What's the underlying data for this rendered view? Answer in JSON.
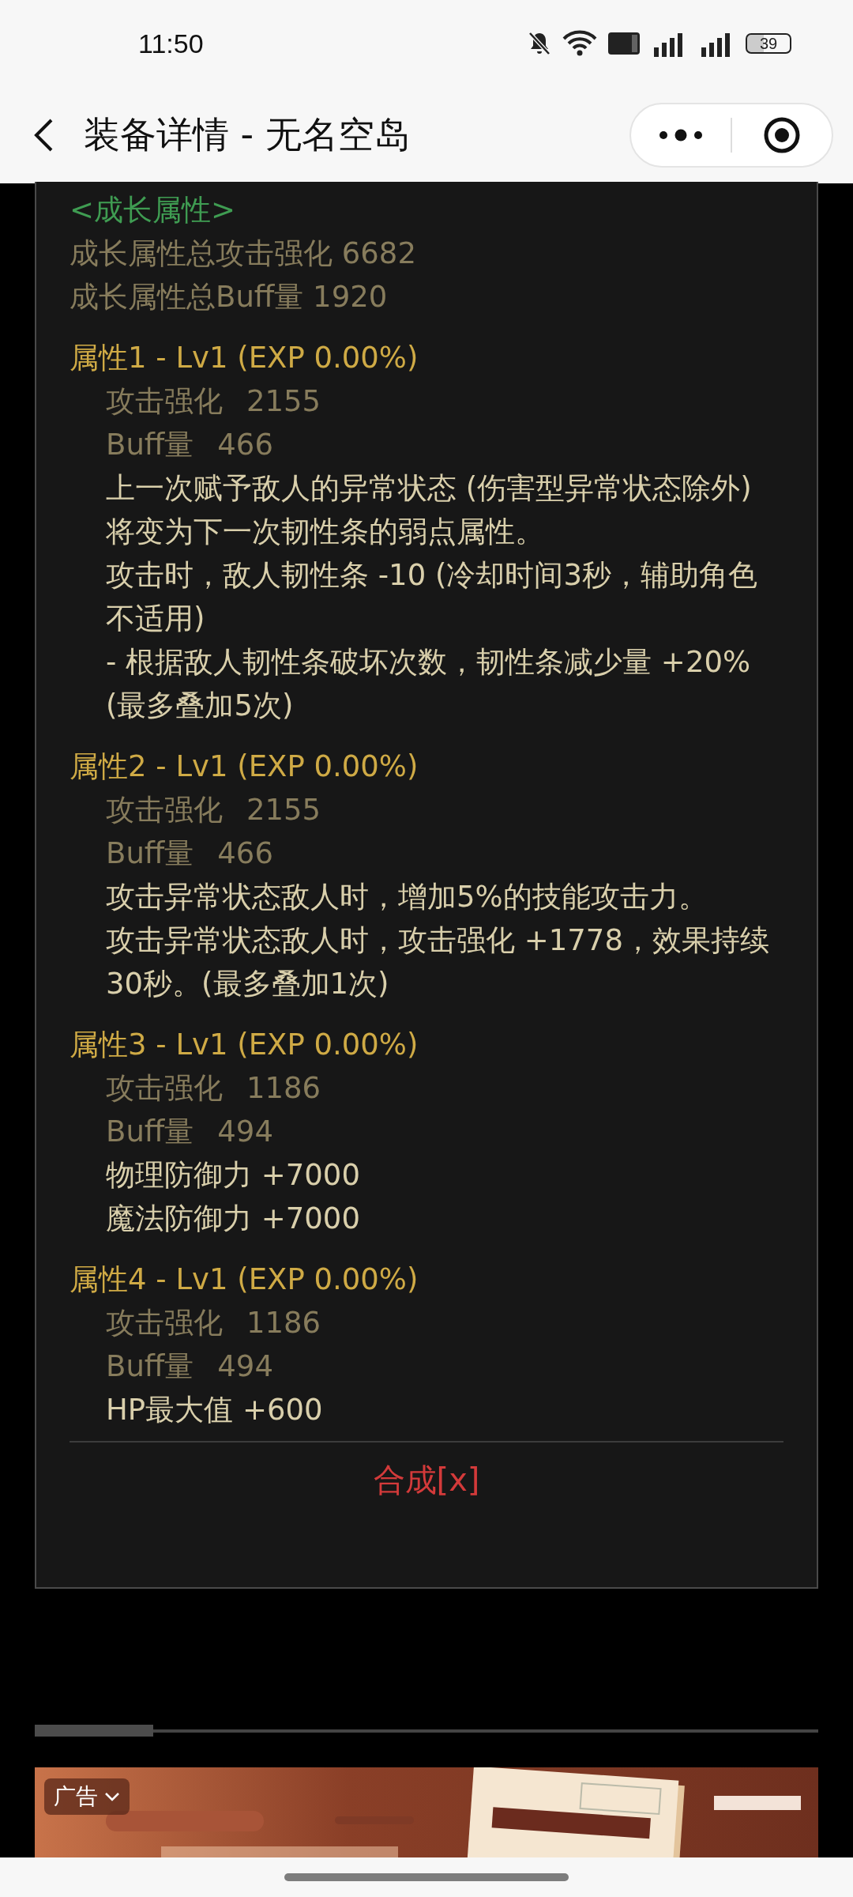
{
  "status_bar": {
    "time": "11:50",
    "battery": "39"
  },
  "header": {
    "title": "装备详情 - 无名空岛"
  },
  "growth": {
    "heading": "<成长属性>",
    "totals": [
      "成长属性总攻击强化 6682",
      "成长属性总Buff量 1920"
    ]
  },
  "attributes": [
    {
      "title": "属性1 - Lv1 (EXP 0.00%)",
      "stats": [
        {
          "label": "攻击强化",
          "value": "2155"
        },
        {
          "label": "Buff量",
          "value": "466"
        }
      ],
      "effects": [
        "上一次赋予敌人的异常状态 (伤害型异常状态除外) 将变为下一次韧性条的弱点属性。",
        "攻击时，敌人韧性条 -10 (冷却时间3秒，辅助角色不适用)",
        "- 根据敌人韧性条破坏次数，韧性条减少量 +20% (最多叠加5次)"
      ]
    },
    {
      "title": "属性2 - Lv1 (EXP 0.00%)",
      "stats": [
        {
          "label": "攻击强化",
          "value": "2155"
        },
        {
          "label": "Buff量",
          "value": "466"
        }
      ],
      "effects": [
        "攻击异常状态敌人时，增加5%的技能攻击力。",
        "攻击异常状态敌人时，攻击强化 +1778，效果持续30秒。(最多叠加1次)"
      ]
    },
    {
      "title": "属性3 - Lv1 (EXP 0.00%)",
      "stats": [
        {
          "label": "攻击强化",
          "value": "1186"
        },
        {
          "label": "Buff量",
          "value": "494"
        }
      ],
      "effects": [
        "物理防御力 +7000",
        "魔法防御力 +7000"
      ]
    },
    {
      "title": "属性4 - Lv1 (EXP 0.00%)",
      "stats": [
        {
          "label": "攻击强化",
          "value": "1186"
        },
        {
          "label": "Buff量",
          "value": "494"
        }
      ],
      "effects": [
        "HP最大值 +600"
      ]
    }
  ],
  "action": {
    "label": "合成[x]"
  },
  "ad": {
    "label": "广告",
    "kind": "picture"
  }
}
